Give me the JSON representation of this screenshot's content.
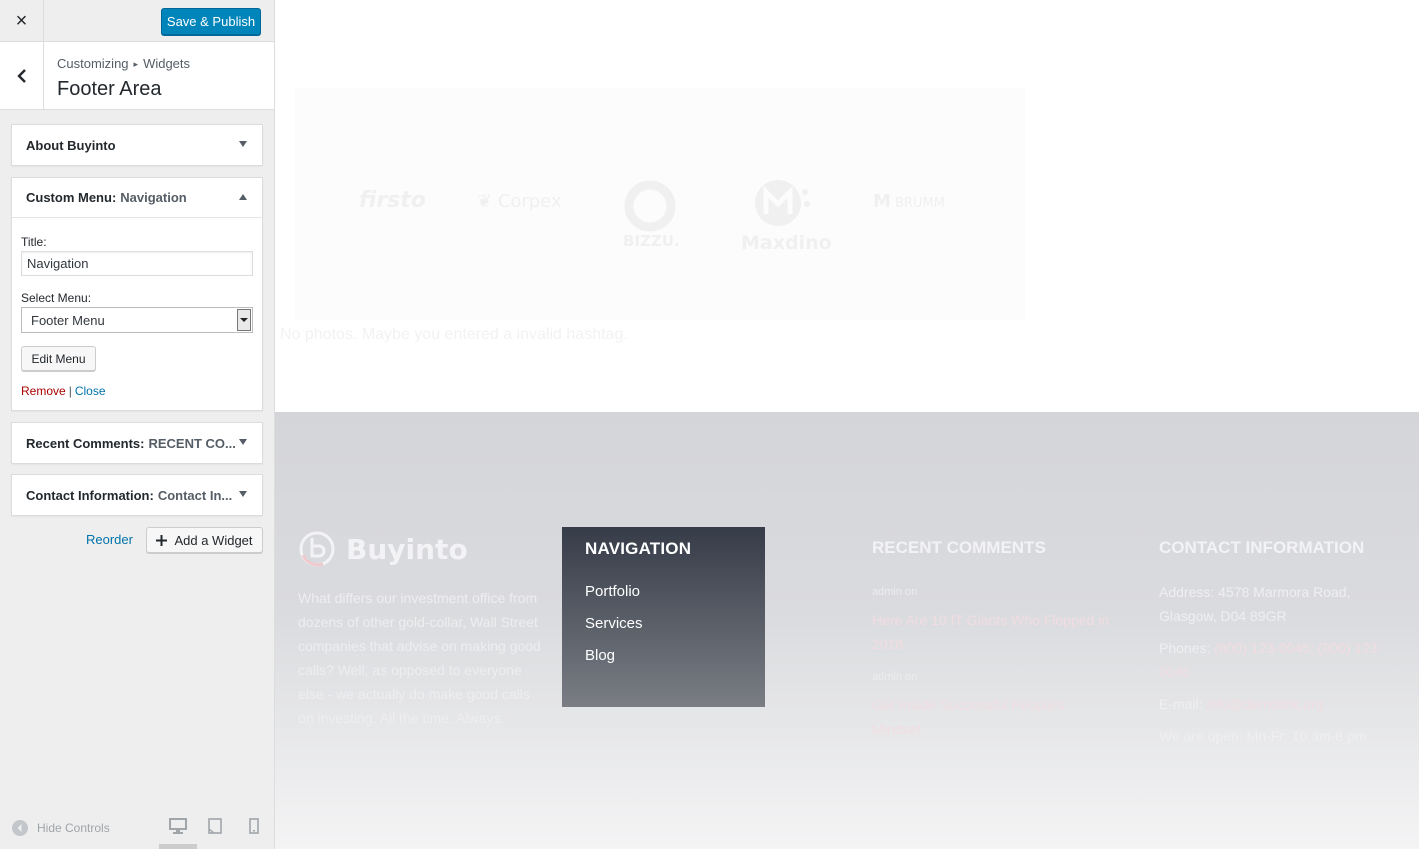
{
  "customizer": {
    "close_label": "×",
    "save_label": "Save & Publish",
    "breadcrumb": [
      "Customizing",
      "Widgets"
    ],
    "breadcrumb_sep": "▸",
    "section_title": "Footer Area",
    "widgets": [
      {
        "name": "About Buyinto",
        "subtitle": ""
      },
      {
        "name": "Custom Menu:",
        "subtitle": "Navigation"
      },
      {
        "name": "Recent Comments:",
        "subtitle": "RECENT CO..."
      },
      {
        "name": "Contact Information:",
        "subtitle": "Contact In..."
      }
    ],
    "menu_widget": {
      "title_label": "Title:",
      "title_value": "Navigation",
      "select_label": "Select Menu:",
      "selected_menu": "Footer Menu",
      "edit_menu_label": "Edit Menu",
      "remove_label": "Remove",
      "pipe": "|",
      "close_label": "Close"
    },
    "reorder_label": "Reorder",
    "add_widget_label": "Add a Widget",
    "hide_controls_label": "Hide Controls"
  },
  "preview": {
    "partners": [
      "firsto",
      "Corpex",
      "BIZZU.",
      "Maxdino",
      "BRUMM"
    ],
    "instagram_message": "No photos. Maybe you entered a invalid hashtag.",
    "footer": {
      "logo_text": "Buyinto",
      "about_text": "What differs our investment office from dozens of other gold-collar, Wall Street companies that advise on making good calls? Well, as opposed to everyone else - we actually do make good calls on investing. All the time. Always.",
      "nav_title": "NAVIGATION",
      "nav_items": [
        "Portfolio",
        "Services",
        "Blog"
      ],
      "recent_comments_title": "RECENT COMMENTS",
      "comments": [
        {
          "meta": "admin  on",
          "link": "Here Are 10 IT Giants Who Flopped in 2016"
        },
        {
          "meta": "admin  on",
          "link": "Get Inside Successful People's Mindset"
        }
      ],
      "contact_title": "CONTACT INFORMATION",
      "address": "Address: 4578 Marmora Road, Glasgow, D04 89GR",
      "phones_label": "Phones:",
      "phones_value": "(800) 123-0045; (800) 123-0046",
      "email_label": "E-mail:",
      "email_value": "info@demolink.org",
      "hours": "We are open: Mn-Fr: 10 am-8 pm"
    }
  },
  "colors": {
    "primary_button": "#0085ba",
    "link": "#0073aa",
    "remove": "#aa0000",
    "nav_box_top": "#363c48"
  }
}
